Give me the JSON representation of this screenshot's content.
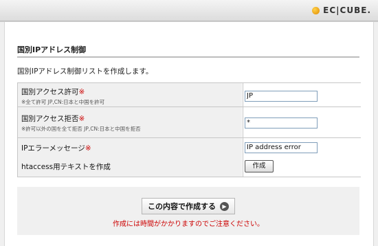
{
  "header": {
    "logo_text": "EC|CUBE."
  },
  "page": {
    "title": "国別IPアドレス制御",
    "intro": "国別IPアドレス制御リストを作成します。"
  },
  "form": {
    "required_mark": "※",
    "rows": [
      {
        "label": "国別アクセス許可",
        "hint": "※全て許可 JP,CN:日本と中国を許可",
        "value": "JP"
      },
      {
        "label": "国別アクセス拒否",
        "hint": "※許可以外の国を全て拒否 JP,CN:日本と中国を拒否",
        "value": "*"
      },
      {
        "label": "IPエラーメッセージ",
        "value": "IP address error"
      },
      {
        "label": "htaccess用テキストを作成",
        "button_label": "作成"
      }
    ]
  },
  "actions": {
    "submit_label": "この内容で作成する",
    "submit_icon": "arrow-right-circle-icon",
    "notice": "作成には時間がかかりますのでご注意ください。"
  },
  "colors": {
    "required": "#cc0000",
    "label_bg": "#f0f0f0",
    "notice": "#cc0000"
  }
}
